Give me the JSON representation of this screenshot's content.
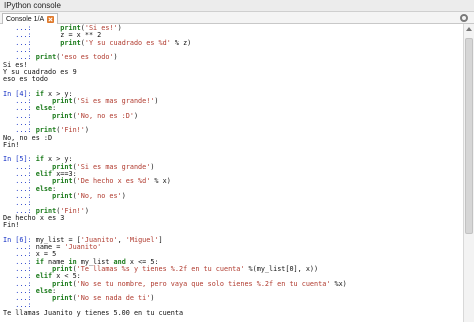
{
  "window": {
    "title": "IPython console"
  },
  "tab": {
    "label": "Console 1/A"
  },
  "console_lines": [
    [
      {
        "t": "   ...:       ",
        "c": "cont"
      },
      {
        "t": "print",
        "c": "kw"
      },
      {
        "t": "(",
        "c": "out"
      },
      {
        "t": "'Si es!'",
        "c": "str"
      },
      {
        "t": ")",
        "c": "out"
      }
    ],
    [
      {
        "t": "   ...:       ",
        "c": "cont"
      },
      {
        "t": "z = x ** 2",
        "c": "out"
      }
    ],
    [
      {
        "t": "   ...:       ",
        "c": "cont"
      },
      {
        "t": "print",
        "c": "kw"
      },
      {
        "t": "(",
        "c": "out"
      },
      {
        "t": "'Y su cuadrado es %d'",
        "c": "str"
      },
      {
        "t": " % z)",
        "c": "out"
      }
    ],
    [
      {
        "t": "   ...:",
        "c": "cont"
      }
    ],
    [
      {
        "t": "   ...: ",
        "c": "cont"
      },
      {
        "t": "print",
        "c": "kw"
      },
      {
        "t": "(",
        "c": "out"
      },
      {
        "t": "'eso es todo'",
        "c": "str"
      },
      {
        "t": ")",
        "c": "out"
      }
    ],
    [
      {
        "t": "Si es!",
        "c": "out"
      }
    ],
    [
      {
        "t": "Y su cuadrado es 9",
        "c": "out"
      }
    ],
    [
      {
        "t": "eso es todo",
        "c": "out"
      }
    ],
    [
      {
        "t": "",
        "c": "out"
      }
    ],
    [
      {
        "t": "In [4]: ",
        "c": "prompt-in"
      },
      {
        "t": "if",
        "c": "kw"
      },
      {
        "t": " x > y:",
        "c": "out"
      }
    ],
    [
      {
        "t": "   ...:     ",
        "c": "cont"
      },
      {
        "t": "print",
        "c": "kw"
      },
      {
        "t": "(",
        "c": "out"
      },
      {
        "t": "'Si es mas grande!'",
        "c": "str"
      },
      {
        "t": ")",
        "c": "out"
      }
    ],
    [
      {
        "t": "   ...: ",
        "c": "cont"
      },
      {
        "t": "else",
        "c": "kw"
      },
      {
        "t": ":",
        "c": "out"
      }
    ],
    [
      {
        "t": "   ...:     ",
        "c": "cont"
      },
      {
        "t": "print",
        "c": "kw"
      },
      {
        "t": "(",
        "c": "out"
      },
      {
        "t": "'No, no es :D'",
        "c": "str"
      },
      {
        "t": ")",
        "c": "out"
      }
    ],
    [
      {
        "t": "   ...:",
        "c": "cont"
      }
    ],
    [
      {
        "t": "   ...: ",
        "c": "cont"
      },
      {
        "t": "print",
        "c": "kw"
      },
      {
        "t": "(",
        "c": "out"
      },
      {
        "t": "'Fin!'",
        "c": "str"
      },
      {
        "t": ")",
        "c": "out"
      }
    ],
    [
      {
        "t": "No, no es :D",
        "c": "out"
      }
    ],
    [
      {
        "t": "Fin!",
        "c": "out"
      }
    ],
    [
      {
        "t": "",
        "c": "out"
      }
    ],
    [
      {
        "t": "In [5]: ",
        "c": "prompt-in"
      },
      {
        "t": "if",
        "c": "kw"
      },
      {
        "t": " x > y:",
        "c": "out"
      }
    ],
    [
      {
        "t": "   ...:     ",
        "c": "cont"
      },
      {
        "t": "print",
        "c": "kw"
      },
      {
        "t": "(",
        "c": "out"
      },
      {
        "t": "'Si es mas grande'",
        "c": "str"
      },
      {
        "t": ")",
        "c": "out"
      }
    ],
    [
      {
        "t": "   ...: ",
        "c": "cont"
      },
      {
        "t": "elif",
        "c": "kw"
      },
      {
        "t": " x==3:",
        "c": "out"
      }
    ],
    [
      {
        "t": "   ...:     ",
        "c": "cont"
      },
      {
        "t": "print",
        "c": "kw"
      },
      {
        "t": "(",
        "c": "out"
      },
      {
        "t": "'De hecho x es %d'",
        "c": "str"
      },
      {
        "t": " % x)",
        "c": "out"
      }
    ],
    [
      {
        "t": "   ...: ",
        "c": "cont"
      },
      {
        "t": "else",
        "c": "kw"
      },
      {
        "t": ":",
        "c": "out"
      }
    ],
    [
      {
        "t": "   ...:     ",
        "c": "cont"
      },
      {
        "t": "print",
        "c": "kw"
      },
      {
        "t": "(",
        "c": "out"
      },
      {
        "t": "'No, no es'",
        "c": "str"
      },
      {
        "t": ")",
        "c": "out"
      }
    ],
    [
      {
        "t": "   ...:",
        "c": "cont"
      }
    ],
    [
      {
        "t": "   ...: ",
        "c": "cont"
      },
      {
        "t": "print",
        "c": "kw"
      },
      {
        "t": "(",
        "c": "out"
      },
      {
        "t": "'Fin!'",
        "c": "str"
      },
      {
        "t": ")",
        "c": "out"
      }
    ],
    [
      {
        "t": "De hecho x es 3",
        "c": "out"
      }
    ],
    [
      {
        "t": "Fin!",
        "c": "out"
      }
    ],
    [
      {
        "t": "",
        "c": "out"
      }
    ],
    [
      {
        "t": "In [6]: ",
        "c": "prompt-in"
      },
      {
        "t": "my_list = [",
        "c": "out"
      },
      {
        "t": "'Juanito'",
        "c": "str"
      },
      {
        "t": ", ",
        "c": "out"
      },
      {
        "t": "'Miguel'",
        "c": "str"
      },
      {
        "t": "]",
        "c": "out"
      }
    ],
    [
      {
        "t": "   ...: ",
        "c": "cont"
      },
      {
        "t": "name = ",
        "c": "out"
      },
      {
        "t": "'Juanito'",
        "c": "str"
      }
    ],
    [
      {
        "t": "   ...: ",
        "c": "cont"
      },
      {
        "t": "x = 5",
        "c": "out"
      }
    ],
    [
      {
        "t": "   ...: ",
        "c": "cont"
      },
      {
        "t": "if",
        "c": "kw"
      },
      {
        "t": " name ",
        "c": "out"
      },
      {
        "t": "in",
        "c": "kw"
      },
      {
        "t": " my_list ",
        "c": "out"
      },
      {
        "t": "and",
        "c": "kw"
      },
      {
        "t": " x <= 5:",
        "c": "out"
      }
    ],
    [
      {
        "t": "   ...:     ",
        "c": "cont"
      },
      {
        "t": "print",
        "c": "kw"
      },
      {
        "t": "(",
        "c": "out"
      },
      {
        "t": "'Te llamas %s y tienes %.2f en tu cuenta'",
        "c": "str"
      },
      {
        "t": " %(my_list[0], x))",
        "c": "out"
      }
    ],
    [
      {
        "t": "   ...: ",
        "c": "cont"
      },
      {
        "t": "elif",
        "c": "kw"
      },
      {
        "t": " x < 5:",
        "c": "out"
      }
    ],
    [
      {
        "t": "   ...:     ",
        "c": "cont"
      },
      {
        "t": "print",
        "c": "kw"
      },
      {
        "t": "(",
        "c": "out"
      },
      {
        "t": "'No se tu nombre, pero vaya que solo tienes %.2f en tu cuenta'",
        "c": "str"
      },
      {
        "t": " %x)",
        "c": "out"
      }
    ],
    [
      {
        "t": "   ...: ",
        "c": "cont"
      },
      {
        "t": "else",
        "c": "kw"
      },
      {
        "t": ":",
        "c": "out"
      }
    ],
    [
      {
        "t": "   ...:     ",
        "c": "cont"
      },
      {
        "t": "print",
        "c": "kw"
      },
      {
        "t": "(",
        "c": "out"
      },
      {
        "t": "'No se nada de ti'",
        "c": "str"
      },
      {
        "t": ")",
        "c": "out"
      }
    ],
    [
      {
        "t": "   ...:",
        "c": "cont"
      }
    ],
    [
      {
        "t": "Te llamas Juanito y tienes 5.00 en tu cuenta",
        "c": "out"
      }
    ]
  ],
  "colors": {
    "prompt": "#1a35c6",
    "keyword": "#1a7a1a",
    "string": "#b03a2e",
    "text": "#111111",
    "tab_close": "#e07a2c"
  },
  "icons": {
    "tab_close": "close-tab-icon",
    "options": "gear-icon",
    "scroll_up": "scroll-up-arrow-icon"
  }
}
